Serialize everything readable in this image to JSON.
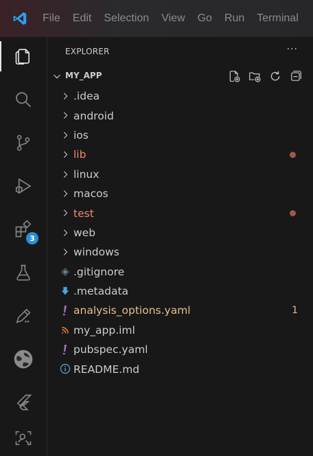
{
  "menu": [
    "File",
    "Edit",
    "Selection",
    "View",
    "Go",
    "Run",
    "Terminal"
  ],
  "activity": {
    "extensions_badge": "3"
  },
  "explorer": {
    "title": "EXPLORER",
    "more": "···",
    "section": "MY_APP",
    "items": [
      {
        "label": ".idea",
        "kind": "folder"
      },
      {
        "label": "android",
        "kind": "folder"
      },
      {
        "label": "ios",
        "kind": "folder"
      },
      {
        "label": "lib",
        "kind": "folder",
        "status": "error"
      },
      {
        "label": "linux",
        "kind": "folder"
      },
      {
        "label": "macos",
        "kind": "folder"
      },
      {
        "label": "test",
        "kind": "folder",
        "status": "error"
      },
      {
        "label": "web",
        "kind": "folder"
      },
      {
        "label": "windows",
        "kind": "folder"
      },
      {
        "label": ".gitignore",
        "kind": "file",
        "icon": "git-icon"
      },
      {
        "label": ".metadata",
        "kind": "file",
        "icon": "download-arrow-icon"
      },
      {
        "label": "analysis_options.yaml",
        "kind": "file",
        "icon": "exclamation-icon",
        "status": "warning",
        "count": "1"
      },
      {
        "label": "my_app.iml",
        "kind": "file",
        "icon": "rss-icon"
      },
      {
        "label": "pubspec.yaml",
        "kind": "file",
        "icon": "exclamation-icon"
      },
      {
        "label": "README.md",
        "kind": "file",
        "icon": "info-icon"
      }
    ]
  },
  "colors": {
    "error": "#f48771",
    "warning": "#e2c08d",
    "badge": "#2b8fd6",
    "accent": "#23a9f2"
  }
}
